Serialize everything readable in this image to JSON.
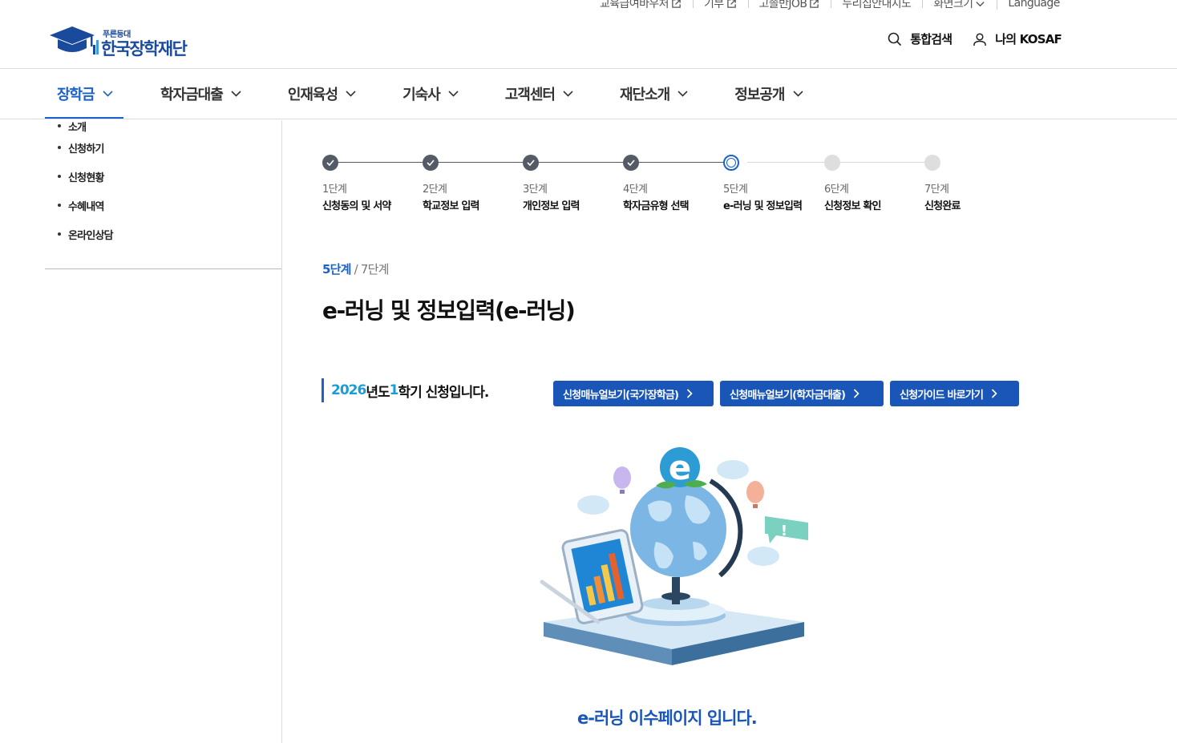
{
  "utility": {
    "items": [
      {
        "label": "교육급여바우처",
        "external": true
      },
      {
        "label": "기부",
        "external": true
      },
      {
        "label": "고졸반JOB",
        "external": true
      },
      {
        "label": "누리집안내지도",
        "external": false
      },
      {
        "label": "화면크기",
        "dropdown": true
      },
      {
        "label": "Language",
        "external": false
      }
    ]
  },
  "logo": {
    "sub": "푸른등대",
    "main": "한국장학재단"
  },
  "header": {
    "search_label": "통합검색",
    "my_label": "나의 KOSAF"
  },
  "gnb": {
    "items": [
      {
        "label": "장학금",
        "active": true
      },
      {
        "label": "학자금대출"
      },
      {
        "label": "인재육성"
      },
      {
        "label": "기숙사"
      },
      {
        "label": "고객센터"
      },
      {
        "label": "재단소개"
      },
      {
        "label": "정보공개"
      }
    ]
  },
  "lnb": {
    "items": [
      "소개",
      "신청하기",
      "신청현황",
      "수혜내역",
      "온라인상담"
    ]
  },
  "steps": {
    "items": [
      {
        "num": "1단계",
        "name": "신청동의 및 서약",
        "state": "done"
      },
      {
        "num": "2단계",
        "name": "학교정보 입력",
        "state": "done"
      },
      {
        "num": "3단계",
        "name": "개인정보 입력",
        "state": "done"
      },
      {
        "num": "4단계",
        "name": "학자금유형 선택",
        "state": "done"
      },
      {
        "num": "5단계",
        "name": "e-러닝 및 정보입력",
        "state": "current"
      },
      {
        "num": "6단계",
        "name": "신청정보 확인",
        "state": "todo"
      },
      {
        "num": "7단계",
        "name": "신청완료",
        "state": "todo"
      }
    ]
  },
  "crumb": {
    "current": "5단계",
    "sep": "/",
    "total": "7단계"
  },
  "page_title": "e-러닝 및 정보입력(e-러닝)",
  "notice": {
    "year": "2026",
    "year_suffix": "년도 ",
    "semester": "1",
    "text": "학기 신청입니다."
  },
  "buttons": [
    {
      "label": "신청매뉴얼보기(국가장학금)"
    },
    {
      "label": "신청매뉴얼보기(학자금대출)"
    },
    {
      "label": "신청가이드 바로가기"
    }
  ],
  "bottom_message": "e-러닝 이수페이지 입니다.",
  "colors": {
    "primary": "#1b63c9",
    "button": "#1a56b8",
    "highlight": "#1a9cd8"
  }
}
